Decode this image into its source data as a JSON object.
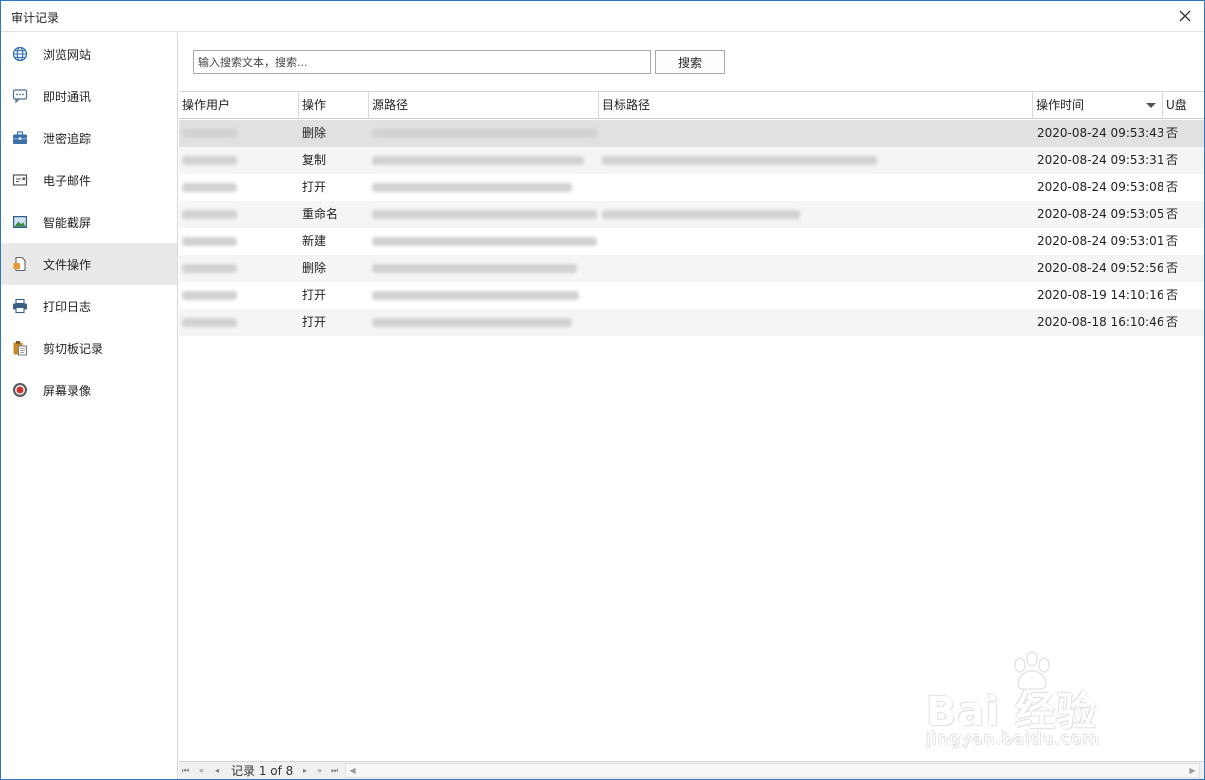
{
  "window": {
    "title": "审计记录"
  },
  "sidebar": {
    "items": [
      {
        "label": "浏览网站",
        "icon": "globe-icon"
      },
      {
        "label": "即时通讯",
        "icon": "chat-icon"
      },
      {
        "label": "泄密追踪",
        "icon": "briefcase-icon"
      },
      {
        "label": "电子邮件",
        "icon": "email-icon"
      },
      {
        "label": "智能截屏",
        "icon": "screenshot-icon"
      },
      {
        "label": "文件操作",
        "icon": "file-icon"
      },
      {
        "label": "打印日志",
        "icon": "printer-icon"
      },
      {
        "label": "剪切板记录",
        "icon": "clipboard-icon"
      },
      {
        "label": "屏幕录像",
        "icon": "record-icon"
      }
    ],
    "active_index": 5
  },
  "search": {
    "placeholder": "输入搜索文本，搜索...",
    "button_label": "搜索"
  },
  "table": {
    "columns": [
      "操作用户",
      "操作",
      "源路径",
      "目标路径",
      "操作时间",
      "U盘"
    ],
    "rows": [
      {
        "operation": "删除",
        "time": "2020-08-24 09:53:43",
        "usb": "否"
      },
      {
        "operation": "复制",
        "time": "2020-08-24 09:53:31",
        "usb": "否"
      },
      {
        "operation": "打开",
        "time": "2020-08-24 09:53:08",
        "usb": "否"
      },
      {
        "operation": "重命名",
        "time": "2020-08-24 09:53:05",
        "usb": "否"
      },
      {
        "operation": "新建",
        "time": "2020-08-24 09:53:01",
        "usb": "否"
      },
      {
        "operation": "删除",
        "time": "2020-08-24 09:52:56",
        "usb": "否"
      },
      {
        "operation": "打开",
        "time": "2020-08-19 14:10:16",
        "usb": "否"
      },
      {
        "operation": "打开",
        "time": "2020-08-18 16:10:46",
        "usb": "否"
      }
    ]
  },
  "pager": {
    "text": "记录 1 of 8"
  },
  "watermark": {
    "main": "Bai 经验",
    "sub": "jingyan.baidu.com"
  }
}
